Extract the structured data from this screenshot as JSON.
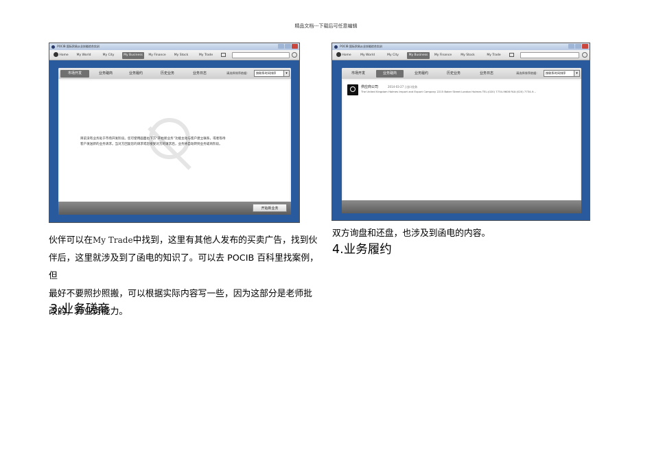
{
  "page_header": "精品文档---下载后可任意编辑",
  "left_shot": {
    "window_title": "POCIB 国际贸易从业技能综合实训",
    "nav": [
      "Home",
      "My World",
      "My City",
      "My Business",
      "My Finance",
      "My Stock",
      "My Trade"
    ],
    "active_nav": "My Business",
    "tabs": [
      "市场开发",
      "业务磋商",
      "业务履约",
      "历史业务",
      "业务日志"
    ],
    "active_tab": "市场开发",
    "sort_label": "请选择排序依据:",
    "sort_value": "按联系时间排序",
    "empty_line1": "目前没有业务处于市场开发阶段。您可使用画面右下方“开始新业务”功能主动与客户建立联系，或者等待",
    "empty_line2": "客户发送新的业务请求。当对方回复您的请求或您接受对方的请求后，业务将自动转到业务磋商阶段。",
    "start_button": "开始新业务"
  },
  "right_shot": {
    "window_title": "POCIB 国际贸易从业技能综合实训",
    "nav": [
      "Home",
      "My World",
      "My City",
      "My Business",
      "My Finance",
      "My Stock",
      "My Trade"
    ],
    "active_nav": "My Business",
    "tabs": [
      "市场开发",
      "业务磋商",
      "业务履约",
      "历史业务",
      "业务日志"
    ],
    "active_tab": "业务磋商",
    "sort_label": "请选择排序依据:",
    "sort_value": "按联系时间排序",
    "company_name": "供应商公司",
    "company_date": "2014-03-27 | 出口业务",
    "company_detail": "The United Kingdom Holmes Import and Export Company 2215 Baker Street London Holmes TEL:(020) 7734-9608 FAX:(020) 7734-9..."
  },
  "left_para": {
    "part1": "伙伴可以在",
    "mono": "My Trade",
    "part2": "中找到，这里有其他人发布的买卖广告，找到伙",
    "line2": "伴后，这里就涉及到了函电的知识了。可以去 POCIB 百科里找案例，但",
    "line3": "最好不要照抄照搬，可以根据实际内容写一些，因为这部分是老师批",
    "line4": "改的，算业务能力。"
  },
  "left_heading": "3.业务磋商",
  "right_caption": "双方询盘和还盘，也涉及到函电的内容。",
  "right_heading": "4.业务履约"
}
